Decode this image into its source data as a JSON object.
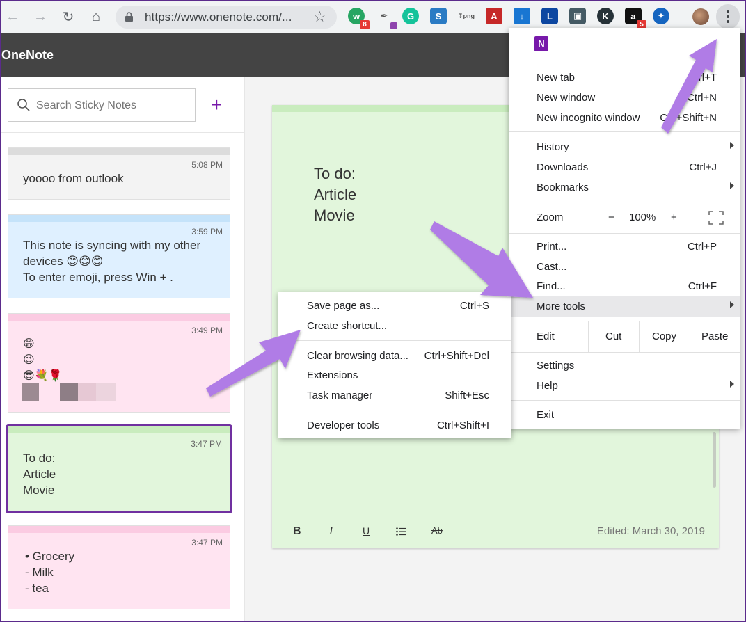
{
  "browser": {
    "url": "https://www.onenote.com/...",
    "extensions": [
      {
        "name": "grammarly-like-icon",
        "badge": "8"
      },
      {
        "name": "k-extension-icon"
      },
      {
        "name": "amazon-icon",
        "badge": "5"
      }
    ]
  },
  "app": {
    "title": "OneNote"
  },
  "sidebar": {
    "search_placeholder": "Search Sticky Notes",
    "add_label": "+",
    "notes": [
      {
        "time": "5:08 PM",
        "lines": [
          "yoooo from outlook"
        ],
        "color": "#f3f3f3"
      },
      {
        "time": "3:59 PM",
        "lines": [
          "This note is syncing with my other",
          "devices  😊😊😊",
          "To enter emoji, press Win + ."
        ],
        "color": "#dff0ff"
      },
      {
        "time": "3:49 PM",
        "lines": [
          "😁",
          "😉",
          "😎💐🌹"
        ],
        "color": "#ffe4f1"
      },
      {
        "time": "3:47 PM",
        "lines": [
          "To do:",
          "Article",
          "Movie"
        ],
        "color": "#e2f6dc"
      },
      {
        "time": "3:47 PM",
        "lines": [
          "•  Grocery",
          "- Milk",
          "- tea"
        ],
        "color": "#ffe4f1"
      }
    ]
  },
  "editor": {
    "lines": [
      "To do:",
      "Article",
      "Movie"
    ],
    "format": {
      "bold": "B",
      "italic": "I",
      "underline": "U",
      "strike": "Ab"
    },
    "edited": "Edited: March 30, 2019"
  },
  "chrome_menu": {
    "new_tab": {
      "label": "New tab",
      "shortcut": "Ctrl+T"
    },
    "new_window": {
      "label": "New window",
      "shortcut": "Ctrl+N"
    },
    "new_incognito": {
      "label": "New incognito window",
      "shortcut": "Ctrl+Shift+N"
    },
    "history": {
      "label": "History"
    },
    "downloads": {
      "label": "Downloads",
      "shortcut": "Ctrl+J"
    },
    "bookmarks": {
      "label": "Bookmarks"
    },
    "zoom": {
      "label": "Zoom",
      "minus": "−",
      "value": "100%",
      "plus": "+"
    },
    "print": {
      "label": "Print...",
      "shortcut": "Ctrl+P"
    },
    "cast": {
      "label": "Cast..."
    },
    "find": {
      "label": "Find...",
      "shortcut": "Ctrl+F"
    },
    "more_tools": {
      "label": "More tools"
    },
    "edit": {
      "label": "Edit",
      "cut": "Cut",
      "copy": "Copy",
      "paste": "Paste"
    },
    "settings": {
      "label": "Settings"
    },
    "help": {
      "label": "Help"
    },
    "exit": {
      "label": "Exit"
    }
  },
  "more_tools_menu": {
    "save_page": {
      "label": "Save page as...",
      "shortcut": "Ctrl+S"
    },
    "create_shortcut": {
      "label": "Create shortcut..."
    },
    "clear_data": {
      "label": "Clear browsing data...",
      "shortcut": "Ctrl+Shift+Del"
    },
    "extensions": {
      "label": "Extensions"
    },
    "task_manager": {
      "label": "Task manager",
      "shortcut": "Shift+Esc"
    },
    "dev_tools": {
      "label": "Developer tools",
      "shortcut": "Ctrl+Shift+I"
    }
  },
  "colors": {
    "accent": "#7719aa",
    "arrow": "#b07be6"
  }
}
